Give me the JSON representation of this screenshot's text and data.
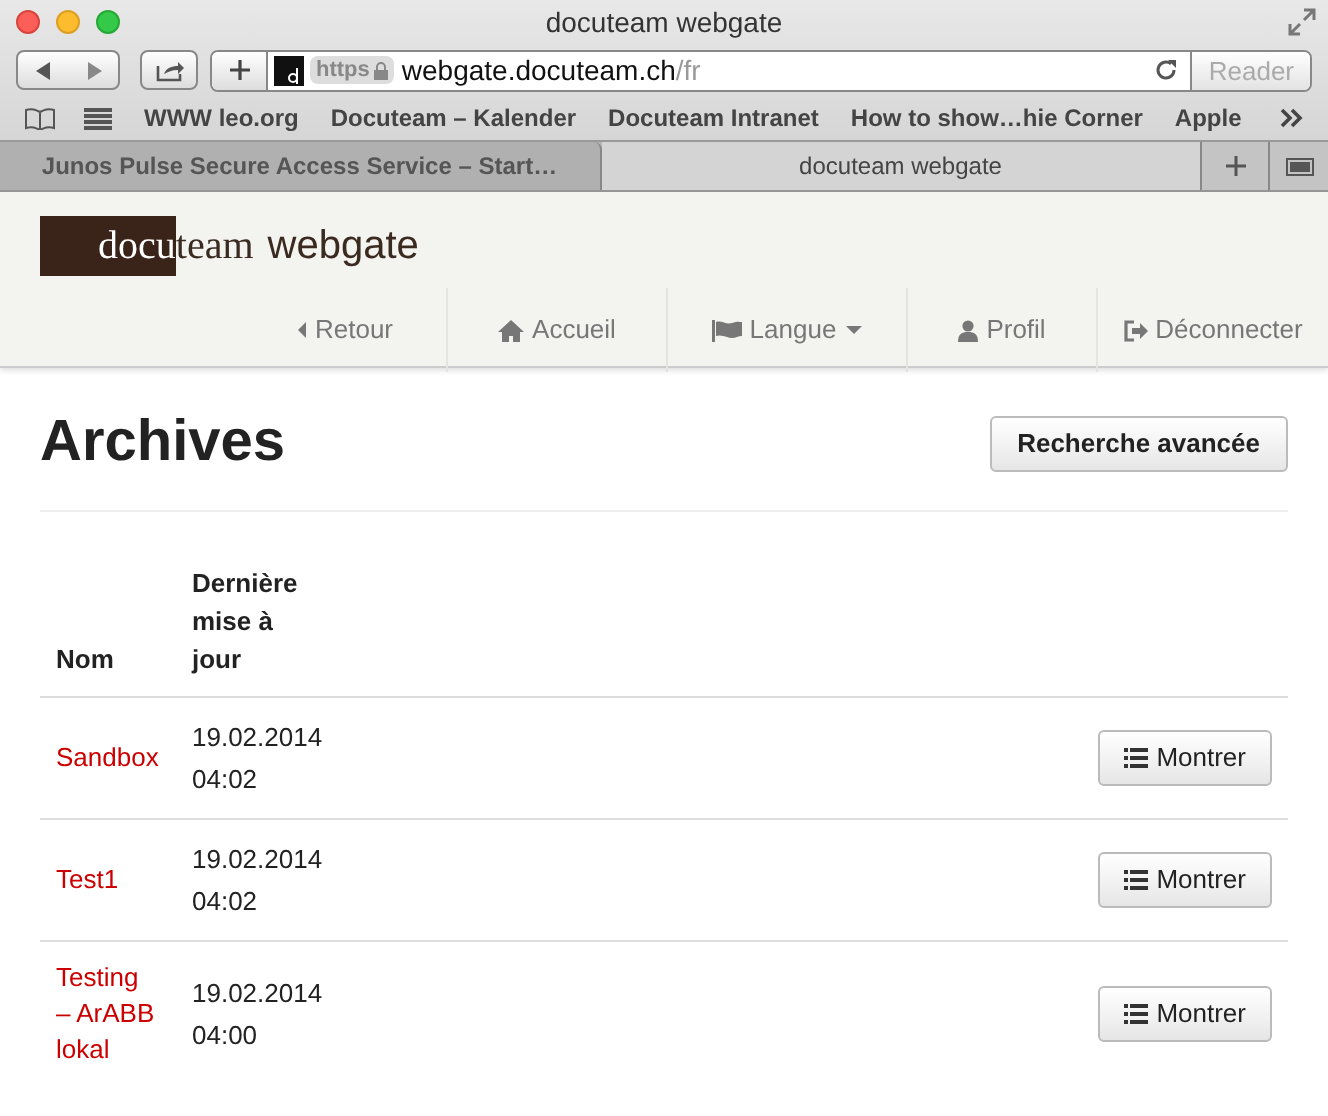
{
  "window": {
    "title": "docuteam webgate"
  },
  "address_bar": {
    "scheme": "https",
    "host": "webgate.docuteam.ch",
    "path": "/fr"
  },
  "reader_button": {
    "label": "Reader",
    "disabled": true
  },
  "bookmarks": [
    "WWW leo.org",
    "Docuteam – Kalender",
    "Docuteam Intranet",
    "How to show…hie Corner",
    "Apple"
  ],
  "tabs": [
    {
      "label": "Junos Pulse Secure Access Service – Start…",
      "selected": false
    },
    {
      "label": "docuteam webgate",
      "selected": true
    }
  ],
  "logo": {
    "dark": "docu",
    "light": "team",
    "suffix": "webgate"
  },
  "nav": [
    {
      "label": "Retour",
      "dropdown": false
    },
    {
      "label": "Accueil",
      "dropdown": false
    },
    {
      "label": "Langue",
      "dropdown": true
    },
    {
      "label": "Profil",
      "dropdown": false
    },
    {
      "label": "Déconnecter",
      "dropdown": false
    }
  ],
  "page": {
    "title": "Archives",
    "action": "Recherche avancée"
  },
  "table": {
    "columns": [
      "Nom",
      "Dernière mise à jour"
    ],
    "rows": [
      {
        "name": "Sandbox",
        "updated": "19.02.2014 04:02",
        "action": "Montrer"
      },
      {
        "name": "Test1",
        "updated": "19.02.2014 04:02",
        "action": "Montrer"
      },
      {
        "name": "Testing – ArABB lokal",
        "updated": "19.02.2014 04:00",
        "action": "Montrer"
      }
    ]
  }
}
